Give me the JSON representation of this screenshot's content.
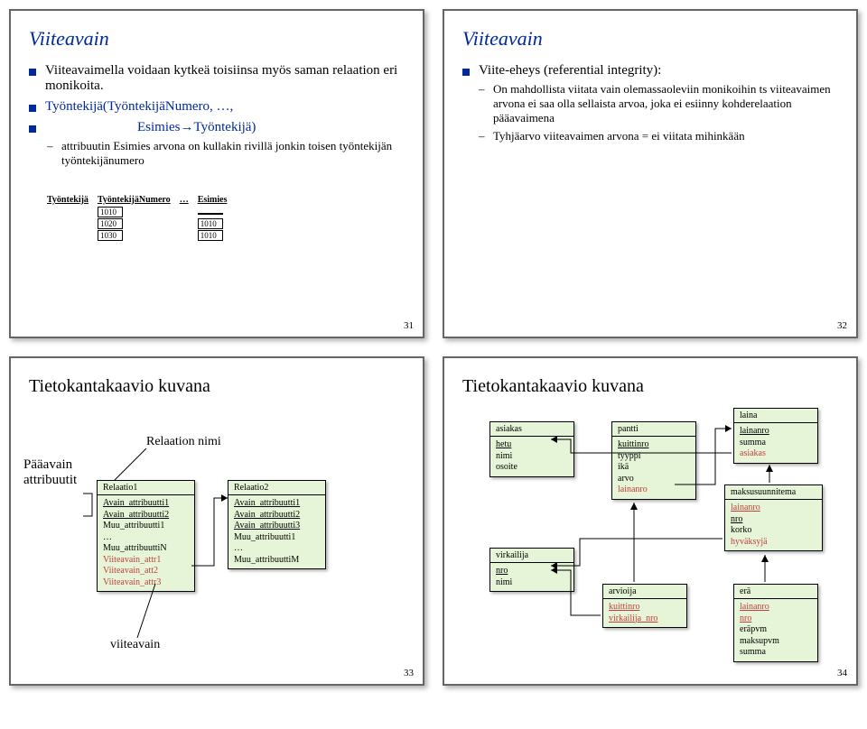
{
  "slide31": {
    "title": "Viiteavain",
    "b1": "Viiteavaimella voidaan kytkeä toisiinsa myös saman relaation eri monikoita.",
    "b2a": "Työntekijä(TyöntekijäNumero, …,",
    "b2b": "Esimies→Työntekijä)",
    "sub1": "attribuutin Esimies arvona on kullakin rivillä jonkin toisen työntekijän työntekijänumero",
    "table": {
      "h1": "Työntekijä",
      "h2": "TyöntekijäNumero",
      "h3": "…",
      "h4": "Esimies",
      "r1c2": "1010",
      "r1c4": "",
      "r2c2": "1020",
      "r2c4": "1010",
      "r3c2": "1030",
      "r3c4": "1010"
    },
    "page": "31"
  },
  "slide32": {
    "title": "Viiteavain",
    "b1": "Viite-eheys (referential integrity):",
    "sub1": "On mahdollista viitata vain olemassaoleviin monikoihin ts viiteavaimen arvona ei saa olla sellaista arvoa, joka ei esiinny kohderelaation pääavaimena",
    "sub2": "Tyhjäarvo viiteavaimen arvona = ei viitata mihinkään",
    "page": "32"
  },
  "slide33": {
    "title": "Tietokantakaavio kuvana",
    "lbl_paa": "Pääavain\nattribuutit",
    "lbl_relnimi": "Relaation nimi",
    "lbl_viite": "viiteavain",
    "rel1": {
      "name": "Relaatio1",
      "attrs": [
        "Avain_attribuutti1",
        "Avain_attribuutti2",
        "Muu_attribuutti1",
        "…",
        "Muu_attribuuttiN",
        "Viiteavain_attr1",
        "Viiteavain_att2",
        "Viiteavain_attr3"
      ]
    },
    "rel2": {
      "name": "Relaatio2",
      "attrs": [
        "Avain_attribuutti1",
        "Avain_attribuutti2",
        "Avain_attribuutti3",
        "Muu_attribuutti1",
        "…",
        "Muu_attribuuttiM"
      ]
    },
    "page": "33"
  },
  "slide34": {
    "title": "Tietokantakaavio kuvana",
    "asiakas": {
      "name": "asiakas",
      "attrs": [
        "hetu",
        "nimi",
        "osoite"
      ]
    },
    "virkailija": {
      "name": "virkailija",
      "attrs": [
        "nro",
        "nimi"
      ]
    },
    "pantti": {
      "name": "pantti",
      "attrs": [
        "kuittinro",
        "tyyppi",
        "ikä",
        "arvo",
        "lainanro"
      ]
    },
    "arvioija": {
      "name": "arvioija",
      "attrs": [
        "kuittinro",
        "virkailija_nro"
      ]
    },
    "laina": {
      "name": "laina",
      "attrs": [
        "lainanro",
        "summa",
        "asiakas"
      ]
    },
    "maksu": {
      "name": "maksusuunnitema",
      "attrs": [
        "lainanro",
        "nro",
        "korko",
        "hyväksyjä"
      ]
    },
    "era": {
      "name": "erä",
      "attrs": [
        "lainanro",
        "nro",
        "eräpvm",
        "maksupvm",
        "summa"
      ]
    },
    "page": "34"
  }
}
